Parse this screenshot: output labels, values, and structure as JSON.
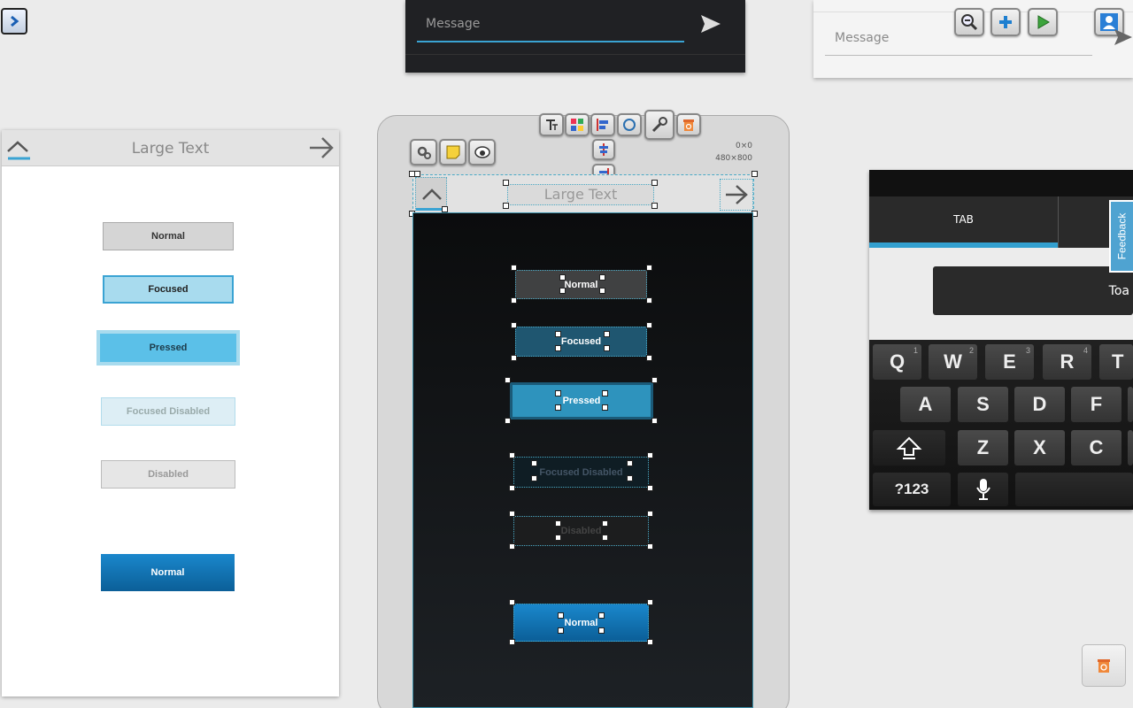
{
  "dark_card": {
    "placeholder": "Message"
  },
  "light_card": {
    "placeholder": "Message"
  },
  "left_preview": {
    "title": "Large Text",
    "buttons": [
      "Normal",
      "Focused",
      "Pressed",
      "Focused Disabled",
      "Disabled",
      "Normal"
    ]
  },
  "phone": {
    "title": "Large Text",
    "dims_1": "0×0",
    "dims_2": "480×800",
    "buttons": [
      "Normal",
      "Focused",
      "Pressed",
      "Focused Disabled",
      "Disabled",
      "Normal"
    ]
  },
  "keyboard_card": {
    "tab_label": "TAB",
    "toast_text": "Toa",
    "row1": [
      {
        "k": "Q",
        "n": "1"
      },
      {
        "k": "W",
        "n": "2"
      },
      {
        "k": "E",
        "n": "3"
      },
      {
        "k": "R",
        "n": "4"
      },
      {
        "k": "T",
        "n": ""
      }
    ],
    "row2": [
      "A",
      "S",
      "D",
      "F"
    ],
    "row3": [
      "Z",
      "X",
      "C"
    ],
    "symbols_key": "?123"
  },
  "feedback_label": "Feedback",
  "colors": {
    "accent": "#3aa3d3",
    "pressed": "#5bc0e8",
    "focused": "#a8dbee",
    "dark_focused": "#1f5670",
    "dark_pressed": "#2e93bd",
    "holo_blue": "#0d78b8"
  }
}
